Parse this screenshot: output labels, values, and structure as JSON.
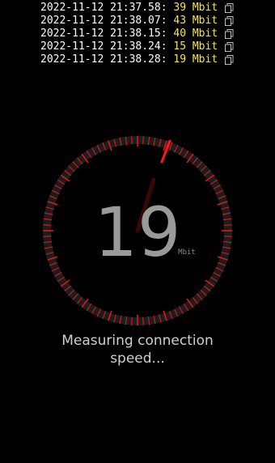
{
  "log": [
    {
      "timestamp": "2022-11-12 21:37.58:",
      "speed": "39 Mbit"
    },
    {
      "timestamp": "2022-11-12 21:38.07:",
      "speed": "43 Mbit"
    },
    {
      "timestamp": "2022-11-12 21:38.15:",
      "speed": "40 Mbit"
    },
    {
      "timestamp": "2022-11-12 21:38.24:",
      "speed": "15 Mbit"
    },
    {
      "timestamp": "2022-11-12 21:38.28:",
      "speed": "19 Mbit"
    }
  ],
  "gauge": {
    "value": "19",
    "unit": "Mbit",
    "accent_color": "#e01818"
  },
  "status": {
    "text": "Measuring connection speed..."
  },
  "icons": {
    "copy": "copy-icon"
  }
}
